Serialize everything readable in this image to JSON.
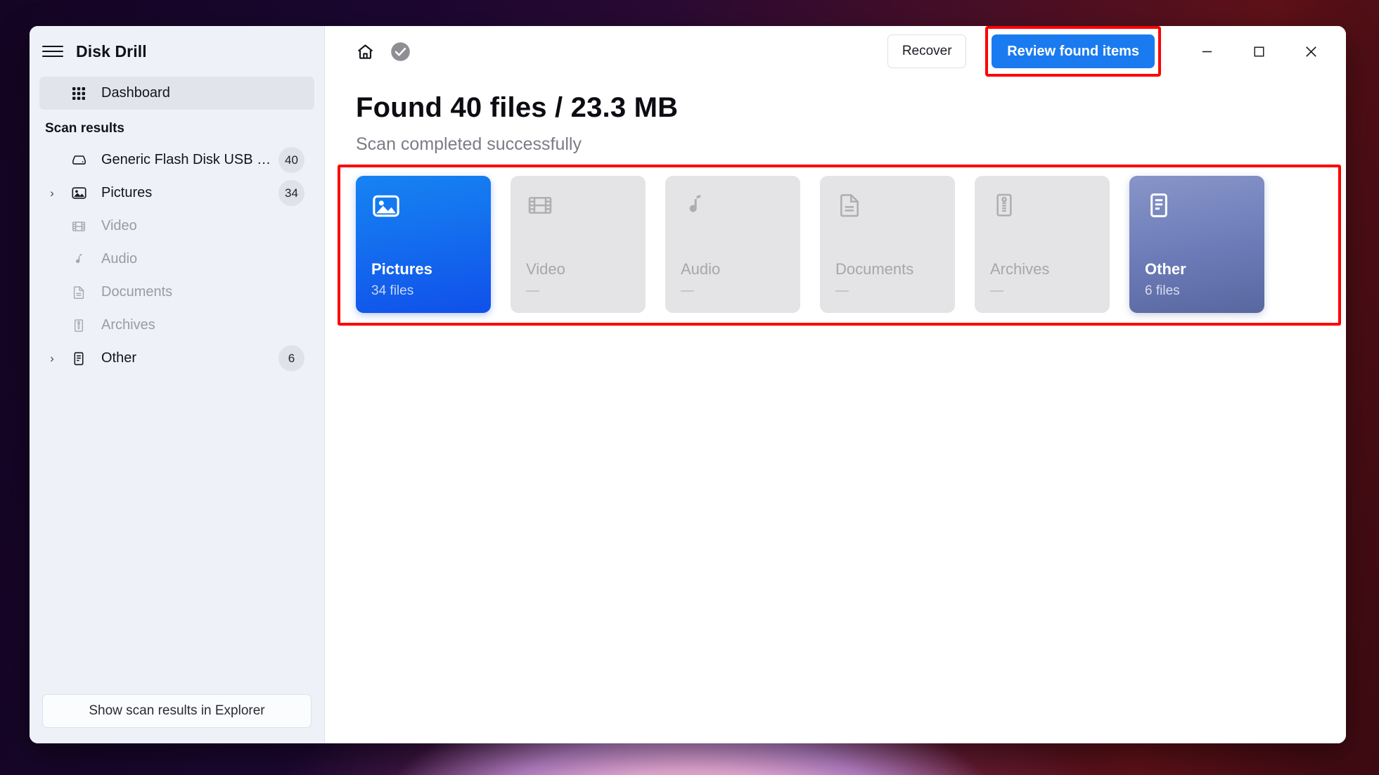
{
  "window": {
    "app_title": "Disk Drill",
    "menu_icon": "hamburger-icon"
  },
  "sidebar": {
    "dashboard": {
      "label": "Dashboard",
      "icon": "grid-dots-icon"
    },
    "section_title": "Scan results",
    "items": [
      {
        "label": "Generic Flash Disk USB D...",
        "badge": "40",
        "icon": "hard-disk-icon",
        "expandable": false,
        "dim": false
      },
      {
        "label": "Pictures",
        "badge": "34",
        "icon": "image-icon",
        "expandable": true,
        "dim": false
      },
      {
        "label": "Video",
        "badge": "",
        "icon": "film-icon",
        "expandable": false,
        "dim": true
      },
      {
        "label": "Audio",
        "badge": "",
        "icon": "music-note-icon",
        "expandable": false,
        "dim": true
      },
      {
        "label": "Documents",
        "badge": "",
        "icon": "document-icon",
        "expandable": false,
        "dim": true
      },
      {
        "label": "Archives",
        "badge": "",
        "icon": "zip-archive-icon",
        "expandable": false,
        "dim": true
      },
      {
        "label": "Other",
        "badge": "6",
        "icon": "other-file-icon",
        "expandable": true,
        "dim": false
      }
    ],
    "explorer_button": "Show scan results in Explorer"
  },
  "toolbar": {
    "home_icon": "home-icon",
    "status_icon": "check-circle-icon",
    "recover_label": "Recover",
    "review_label": "Review found items",
    "minimize_icon": "minimize-icon",
    "maximize_icon": "maximize-icon",
    "close_icon": "close-icon"
  },
  "main": {
    "title": "Found 40 files / 23.3 MB",
    "subtitle": "Scan completed successfully",
    "cards": [
      {
        "name": "Pictures",
        "count": "34 files",
        "icon": "image-icon",
        "state": "pictures"
      },
      {
        "name": "Video",
        "count": "—",
        "icon": "film-icon",
        "state": "inactive"
      },
      {
        "name": "Audio",
        "count": "—",
        "icon": "music-note-icon",
        "state": "inactive"
      },
      {
        "name": "Documents",
        "count": "—",
        "icon": "document-icon",
        "state": "inactive"
      },
      {
        "name": "Archives",
        "count": "—",
        "icon": "zip-archive-icon",
        "state": "inactive"
      },
      {
        "name": "Other",
        "count": "6 files",
        "icon": "other-file-icon",
        "state": "other"
      }
    ]
  },
  "annotations": {
    "review_button_highlight_color": "#ff0000",
    "cards_highlight_color": "#ff0000"
  },
  "colors": {
    "accent_blue": "#1a7bf0",
    "sidebar_bg": "#eef1f8",
    "card_inactive": "#e4e4e6",
    "other_card": "#6c7bb8"
  }
}
